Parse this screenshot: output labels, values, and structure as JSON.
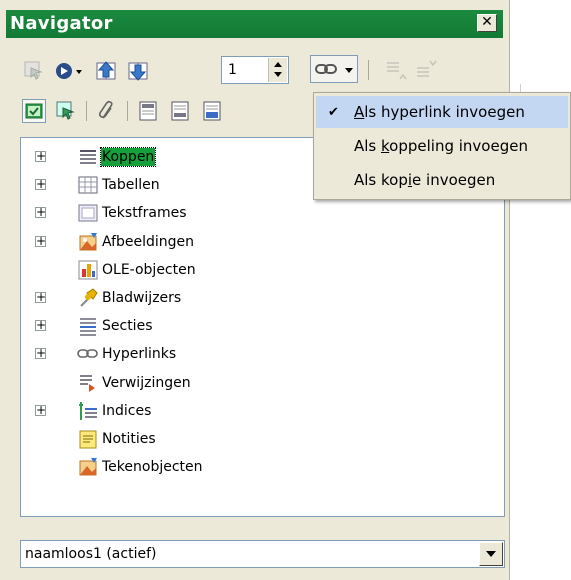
{
  "window": {
    "title": "Navigator",
    "close_glyph": "✕"
  },
  "toolbar": {
    "page_number": "1",
    "items_row1": [
      "content-view-icon",
      "navigation-icon",
      "previous-icon",
      "next-icon"
    ],
    "items_row2": [
      "dragmode-icon",
      "promote-icon",
      "reminder-icon",
      "header-icon",
      "footer-icon",
      "anchor-icon"
    ]
  },
  "tree": {
    "items": [
      {
        "label": "Koppen",
        "expandable": true,
        "selected": true,
        "icon": "headings-icon"
      },
      {
        "label": "Tabellen",
        "expandable": true,
        "selected": false,
        "icon": "table-icon"
      },
      {
        "label": "Tekstframes",
        "expandable": true,
        "selected": false,
        "icon": "frame-icon"
      },
      {
        "label": "Afbeeldingen",
        "expandable": true,
        "selected": false,
        "icon": "image-icon"
      },
      {
        "label": "OLE-objecten",
        "expandable": false,
        "selected": false,
        "icon": "ole-icon"
      },
      {
        "label": "Bladwijzers",
        "expandable": true,
        "selected": false,
        "icon": "bookmark-icon"
      },
      {
        "label": "Secties",
        "expandable": true,
        "selected": false,
        "icon": "section-icon"
      },
      {
        "label": "Hyperlinks",
        "expandable": true,
        "selected": false,
        "icon": "hyperlink-icon"
      },
      {
        "label": "Verwijzingen",
        "expandable": false,
        "selected": false,
        "icon": "reference-icon"
      },
      {
        "label": "Indices",
        "expandable": true,
        "selected": false,
        "icon": "index-icon"
      },
      {
        "label": "Notities",
        "expandable": false,
        "selected": false,
        "icon": "note-icon"
      },
      {
        "label": "Tekenobjecten",
        "expandable": false,
        "selected": false,
        "icon": "drawing-icon"
      }
    ]
  },
  "document_select": {
    "value": "naamloos1 (actief)"
  },
  "drag_mode_menu": {
    "items": [
      {
        "label": "Als hyperlink invoegen",
        "mnemonic": "A",
        "checked": true,
        "highlighted": true
      },
      {
        "label": "Als koppeling invoegen",
        "mnemonic": "k",
        "checked": false,
        "highlighted": false
      },
      {
        "label": "Als kopie invoegen",
        "mnemonic": "i",
        "checked": false,
        "highlighted": false
      }
    ],
    "check_glyph": "✔"
  },
  "colors": {
    "titlebar": "#1b8a3e",
    "selection": "#15a03c",
    "menu_highlight": "#c3d6f2"
  }
}
